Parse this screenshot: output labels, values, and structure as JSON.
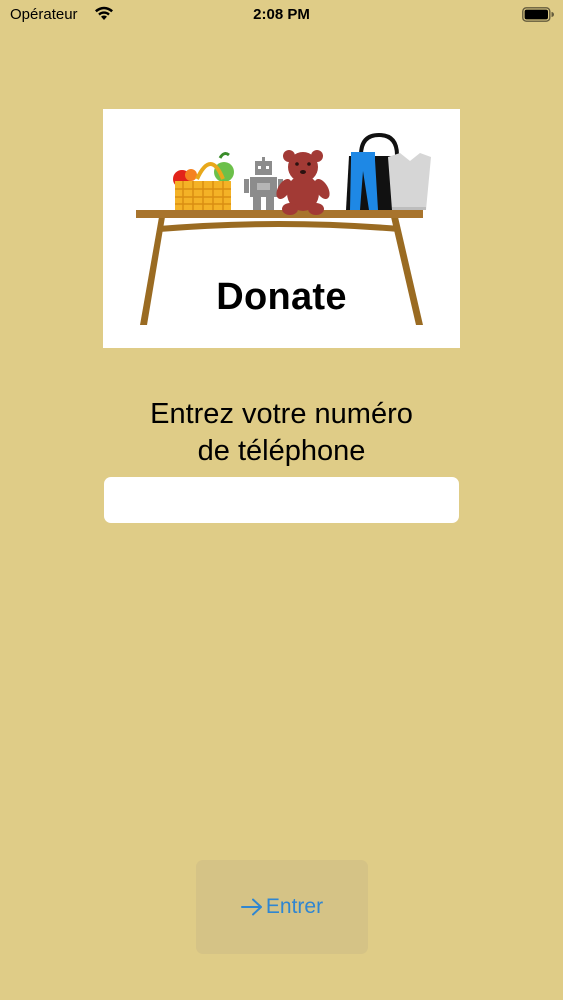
{
  "status_bar": {
    "carrier": "Opérateur",
    "time": "2:08 PM"
  },
  "banner": {
    "title": "Donate"
  },
  "form": {
    "prompt_line1": "Entrez votre numéro",
    "prompt_line2": "de téléphone",
    "phone_value": "",
    "phone_placeholder": ""
  },
  "actions": {
    "enter_label": "Entrer"
  },
  "colors": {
    "background": "#dfcc87",
    "button_bg": "#d5c386",
    "accent": "#2f86d1"
  },
  "icons": {
    "wifi": "wifi-icon",
    "battery": "battery-icon",
    "arrow": "arrow-right-icon"
  }
}
